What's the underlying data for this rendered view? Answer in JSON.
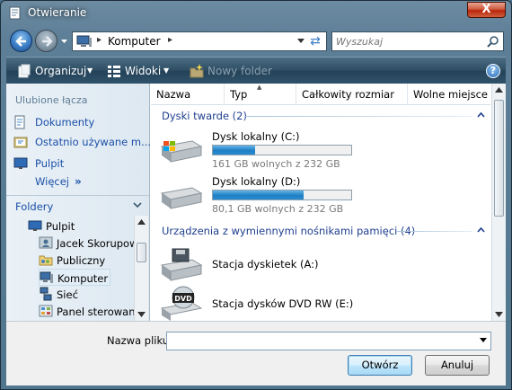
{
  "window": {
    "title": "Otwieranie",
    "close_label": "X"
  },
  "navbar": {
    "address_path": "Komputer",
    "search_placeholder": "Wyszukaj"
  },
  "toolbar": {
    "organize": "Organizuj",
    "views": "Widoki",
    "new_folder": "Nowy folder",
    "help": "?"
  },
  "favorites": {
    "heading": "Ulubione łącza",
    "items": [
      {
        "label": "Dokumenty",
        "icon": "documents-icon"
      },
      {
        "label": "Ostatnio używane m...",
        "icon": "recent-icon"
      },
      {
        "label": "Pulpit",
        "icon": "desktop-icon"
      }
    ],
    "more": "Więcej",
    "more_arrows": "»"
  },
  "folders": {
    "heading": "Foldery",
    "tree": [
      {
        "label": "Pulpit",
        "icon": "desktop-icon",
        "level": 0
      },
      {
        "label": "Jacek Skorupowski",
        "icon": "user-folder-icon",
        "level": 1
      },
      {
        "label": "Publiczny",
        "icon": "public-folder-icon",
        "level": 1
      },
      {
        "label": "Komputer",
        "icon": "computer-icon",
        "level": 1,
        "selected": true
      },
      {
        "label": "Sieć",
        "icon": "network-icon",
        "level": 1
      },
      {
        "label": "Panel sterowania",
        "icon": "control-panel-icon",
        "level": 1
      }
    ]
  },
  "columns": [
    "Nazwa",
    "Typ",
    "Całkowity rozmiar",
    "Wolne miejsce"
  ],
  "groups": {
    "hard_drives": "Dyski twarde (2)",
    "removable": "Urządzenia z wymiennymi nośnikami pamięci (4)"
  },
  "drives": [
    {
      "name": "Dysk lokalny (C:)",
      "info": "161 GB wolnych z 232 GB",
      "used_fraction": 0.306
    },
    {
      "name": "Dysk lokalny (D:)",
      "info": "80,1 GB wolnych z 232 GB",
      "used_fraction": 0.655
    }
  ],
  "devices": [
    {
      "name": "Stacja dyskietek (A:)",
      "icon": "floppy-drive-icon"
    },
    {
      "name": "Stacja dysków DVD RW (E:)",
      "icon": "dvd-drive-icon"
    }
  ],
  "bottom": {
    "filename_label": "Nazwa pliku:",
    "filename_value": "",
    "open_button": "Otwórz",
    "cancel_button": "Anuluj"
  }
}
